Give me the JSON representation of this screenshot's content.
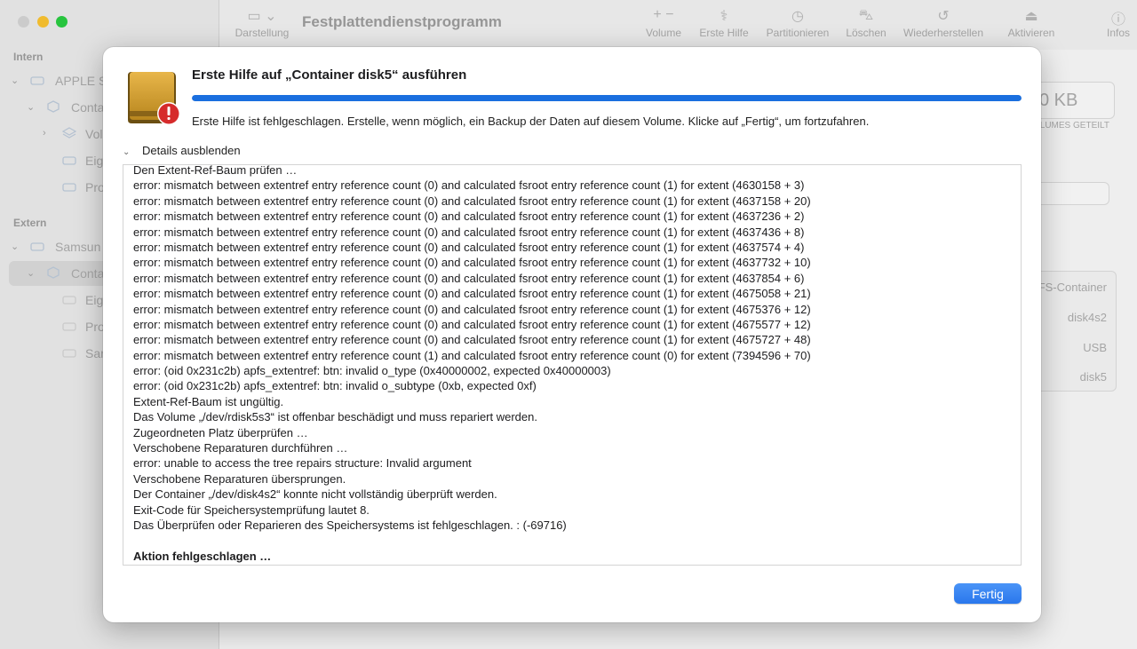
{
  "app": {
    "title": "Festplattendienstprogramm"
  },
  "toolbar": {
    "view_label": "Darstellung",
    "buttons": [
      {
        "label": "Volume",
        "icon": "plus-minus-icon"
      },
      {
        "label": "Erste Hilfe",
        "icon": "stethoscope-icon"
      },
      {
        "label": "Partitionieren",
        "icon": "partition-icon"
      },
      {
        "label": "Löschen",
        "icon": "erase-icon"
      },
      {
        "label": "Wiederherstellen",
        "icon": "restore-icon"
      },
      {
        "label": "Aktivieren",
        "icon": "mount-icon"
      },
      {
        "label": "Infos",
        "icon": "info-icon"
      }
    ]
  },
  "sidebar": {
    "sections": [
      "Intern",
      "Extern"
    ],
    "items": [
      {
        "label": "APPLE S"
      },
      {
        "label": "Conta"
      },
      {
        "label": "Vol"
      },
      {
        "label": "Eig"
      },
      {
        "label": "Pro"
      },
      {
        "label": "Samsun"
      },
      {
        "label": "Conta"
      },
      {
        "label": "Eig"
      },
      {
        "label": "Pro"
      },
      {
        "label": "Sar"
      }
    ]
  },
  "main_background": {
    "capacity": "0 KB",
    "capacity_caption": "OLUMES GETEILT",
    "rows": [
      "FS-Container",
      "disk4s2",
      "USB",
      "disk5"
    ]
  },
  "sheet": {
    "title": "Erste Hilfe auf „Container disk5“ ausführen",
    "progress": 1.0,
    "message": "Erste Hilfe ist fehlgeschlagen. Erstelle, wenn möglich, ein Backup der Daten auf diesem Volume. Klicke auf „Fertig“, um fortzufahren.",
    "details_label": "Details ausblenden",
    "done_label": "Fertig",
    "colors": {
      "accent": "#1a6fdf",
      "error_badge": "#d62b2b"
    },
    "log": [
      {
        "text": "Den Extent-Ref-Baum prüfen …",
        "bold": false
      },
      {
        "text": "error: mismatch between extentref entry reference count (0) and calculated fsroot entry reference count (1) for extent (4630158 + 3)",
        "bold": false
      },
      {
        "text": "error: mismatch between extentref entry reference count (0) and calculated fsroot entry reference count (1) for extent (4637158 + 20)",
        "bold": false
      },
      {
        "text": "error: mismatch between extentref entry reference count (0) and calculated fsroot entry reference count (1) for extent (4637236 + 2)",
        "bold": false
      },
      {
        "text": "error: mismatch between extentref entry reference count (0) and calculated fsroot entry reference count (1) for extent (4637436 + 8)",
        "bold": false
      },
      {
        "text": "error: mismatch between extentref entry reference count (0) and calculated fsroot entry reference count (1) for extent (4637574 + 4)",
        "bold": false
      },
      {
        "text": "error: mismatch between extentref entry reference count (0) and calculated fsroot entry reference count (1) for extent (4637732 + 10)",
        "bold": false
      },
      {
        "text": "error: mismatch between extentref entry reference count (0) and calculated fsroot entry reference count (1) for extent (4637854 + 6)",
        "bold": false
      },
      {
        "text": "error: mismatch between extentref entry reference count (0) and calculated fsroot entry reference count (1) for extent (4675058 + 21)",
        "bold": false
      },
      {
        "text": "error: mismatch between extentref entry reference count (0) and calculated fsroot entry reference count (1) for extent (4675376 + 12)",
        "bold": false
      },
      {
        "text": "error: mismatch between extentref entry reference count (0) and calculated fsroot entry reference count (1) for extent (4675577 + 12)",
        "bold": false
      },
      {
        "text": "error: mismatch between extentref entry reference count (0) and calculated fsroot entry reference count (1) for extent (4675727 + 48)",
        "bold": false
      },
      {
        "text": "error: mismatch between extentref entry reference count (1) and calculated fsroot entry reference count (0) for extent (7394596 + 70)",
        "bold": false
      },
      {
        "text": "error: (oid 0x231c2b) apfs_extentref: btn: invalid o_type (0x40000002, expected 0x40000003)",
        "bold": false
      },
      {
        "text": "error: (oid 0x231c2b) apfs_extentref: btn: invalid o_subtype (0xb, expected 0xf)",
        "bold": false
      },
      {
        "text": "Extent-Ref-Baum ist ungültig.",
        "bold": false
      },
      {
        "text": "Das Volume „/dev/rdisk5s3“ ist offenbar beschädigt und muss repariert werden.",
        "bold": false
      },
      {
        "text": "Zugeordneten Platz überprüfen …",
        "bold": false
      },
      {
        "text": "Verschobene Reparaturen durchführen …",
        "bold": false
      },
      {
        "text": "error: unable to access the tree repairs structure: Invalid argument",
        "bold": false
      },
      {
        "text": "Verschobene Reparaturen übersprungen.",
        "bold": false
      },
      {
        "text": "Der Container „/dev/disk4s2“ konnte nicht vollständig überprüft werden.",
        "bold": false
      },
      {
        "text": "Exit-Code für Speichersystemprüfung lautet 8.",
        "bold": false
      },
      {
        "text": "Das Überprüfen oder Reparieren des Speichersystems ist fehlgeschlagen. : (-69716)",
        "bold": false
      },
      {
        "text": "",
        "bold": false
      },
      {
        "text": "Aktion fehlgeschlagen …",
        "bold": true
      }
    ]
  }
}
